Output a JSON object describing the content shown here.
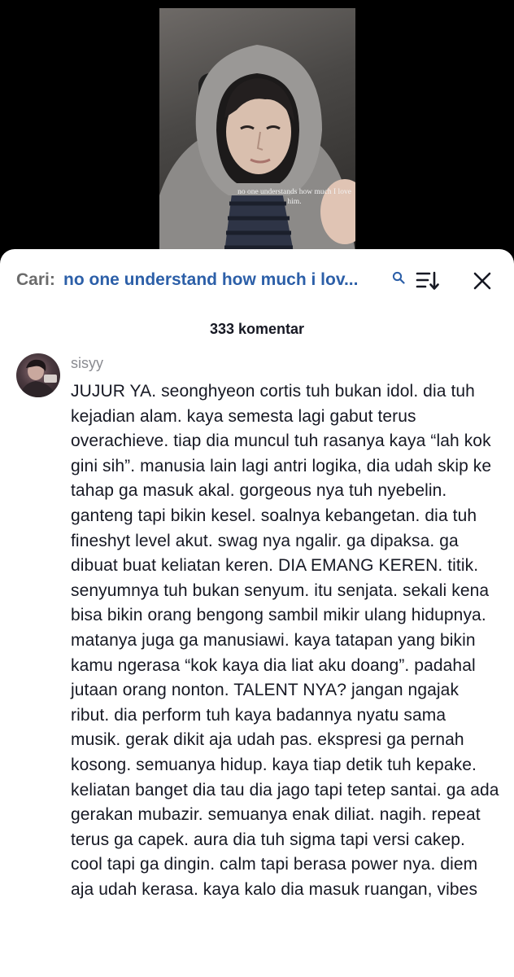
{
  "video": {
    "caption": "no one understands how much I love him."
  },
  "search": {
    "prefix": "Cari:",
    "query": "no one understand how much i lov...",
    "icons": [
      "search-icon",
      "sort-icon",
      "close-icon"
    ]
  },
  "comments_header": {
    "count_label": "333 komentar"
  },
  "comment": {
    "username": "sisyy",
    "text": "JUJUR YA. seonghyeon cortis tuh bukan idol. dia tuh kejadian alam. kaya semesta lagi gabut terus overachieve. tiap dia muncul tuh rasanya kaya “lah kok gini sih”. manusia lain lagi antri logika, dia udah skip ke tahap ga masuk akal. gorgeous nya tuh nyebelin. ganteng tapi bikin kesel. soalnya kebangetan. dia tuh fineshyt level akut. swag nya ngalir. ga dipaksa. ga dibuat buat keliatan keren. DIA EMANG KEREN. titik. senyumnya tuh bukan senyum. itu senjata. sekali kena bisa bikin orang bengong sambil mikir ulang hidupnya. matanya juga ga manusiawi. kaya tatapan yang bikin kamu ngerasa “kok kaya dia liat aku doang”. padahal jutaan orang nonton. TALENT NYA? jangan ngajak ribut. dia perform tuh kaya badannya nyatu sama musik. gerak dikit aja udah pas. ekspresi ga pernah kosong. semuanya hidup. kaya tiap detik tuh kepake. keliatan banget dia tau dia jago tapi tetep santai. ga ada gerakan mubazir. semuanya enak diliat. nagih. repeat terus ga capek. aura dia tuh sigma tapi versi cakep. cool tapi ga dingin. calm tapi berasa power nya. diem aja udah kerasa. kaya kalo dia masuk ruangan, vibes"
  },
  "colors": {
    "sheet_bg": "#ffffff",
    "query_blue": "#2c5fa8",
    "prefix_gray": "#6b6b6b",
    "username_gray": "#8a8b91",
    "text": "#161823"
  }
}
